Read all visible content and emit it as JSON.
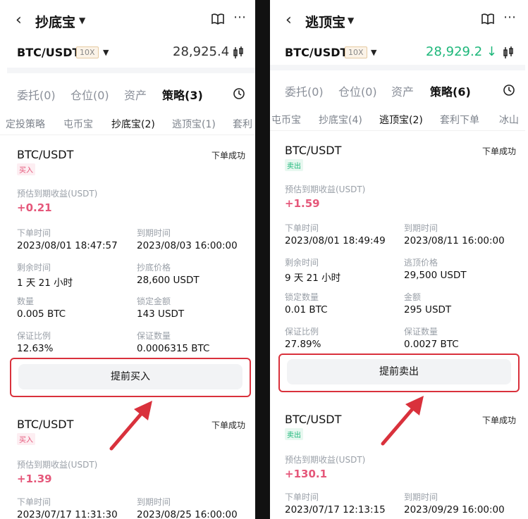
{
  "left": {
    "title": "抄底宝",
    "pair": "BTC/USDT",
    "leverage": "10X",
    "price": "28,925.4",
    "tabs": [
      "委托(0)",
      "仓位(0)",
      "资产",
      "策略(3)"
    ],
    "subtabs": [
      "定投策略",
      "屯币宝",
      "抄底宝(2)",
      "逃顶宝(1)",
      "套利"
    ],
    "cards": [
      {
        "pair": "BTC/USDT",
        "status": "下单成功",
        "side": "买入",
        "est_label": "预估到期收益(USDT)",
        "est_value": "+0.21",
        "fields": [
          {
            "label": "下单时间",
            "value": "2023/08/01 18:47:57"
          },
          {
            "label": "到期时间",
            "value": "2023/08/03 16:00:00"
          },
          {
            "label": "剩余时间",
            "value": "1 天 21 小时"
          },
          {
            "label": "抄底价格",
            "value": "28,600 USDT"
          },
          {
            "label": "数量",
            "value": "0.005 BTC"
          },
          {
            "label": "锁定金额",
            "value": "143 USDT"
          },
          {
            "label": "保证比例",
            "value": "12.63%"
          },
          {
            "label": "保证数量",
            "value": "0.0006315 BTC"
          }
        ],
        "button": "提前买入"
      },
      {
        "pair": "BTC/USDT",
        "status": "下单成功",
        "side": "买入",
        "est_label": "预估到期收益(USDT)",
        "est_value": "+1.39",
        "fields": [
          {
            "label": "下单时间",
            "value": "2023/07/17 11:31:30"
          },
          {
            "label": "到期时间",
            "value": "2023/08/25 16:00:00"
          }
        ]
      }
    ]
  },
  "right": {
    "title": "逃顶宝",
    "pair": "BTC/USDT",
    "leverage": "10X",
    "price": "28,929.2 ↓",
    "tabs": [
      "委托(0)",
      "仓位(0)",
      "资产",
      "策略(6)"
    ],
    "subtabs": [
      "屯币宝",
      "抄底宝(4)",
      "逃顶宝(2)",
      "套利下单",
      "冰山"
    ],
    "cards": [
      {
        "pair": "BTC/USDT",
        "status": "下单成功",
        "side": "卖出",
        "est_label": "预估到期收益(USDT)",
        "est_value": "+1.59",
        "fields": [
          {
            "label": "下单时间",
            "value": "2023/08/01 18:49:49"
          },
          {
            "label": "到期时间",
            "value": "2023/08/11 16:00:00"
          },
          {
            "label": "剩余时间",
            "value": "9 天 21 小时"
          },
          {
            "label": "逃顶价格",
            "value": "29,500 USDT"
          },
          {
            "label": "锁定数量",
            "value": "0.01 BTC"
          },
          {
            "label": "金额",
            "value": "295 USDT"
          },
          {
            "label": "保证比例",
            "value": "27.89%"
          },
          {
            "label": "保证数量",
            "value": "0.0027 BTC"
          }
        ],
        "button": "提前卖出"
      },
      {
        "pair": "BTC/USDT",
        "status": "下单成功",
        "side": "卖出",
        "est_label": "预估到期收益(USDT)",
        "est_value": "+130.1",
        "fields": [
          {
            "label": "下单时间",
            "value": "2023/07/17 12:13:15"
          },
          {
            "label": "到期时间",
            "value": "2023/09/29 16:00:00"
          }
        ]
      }
    ]
  },
  "colors": {
    "annotation_red": "#d9313c",
    "buy_pink": "#e5577a",
    "sell_green": "#1db77a"
  }
}
